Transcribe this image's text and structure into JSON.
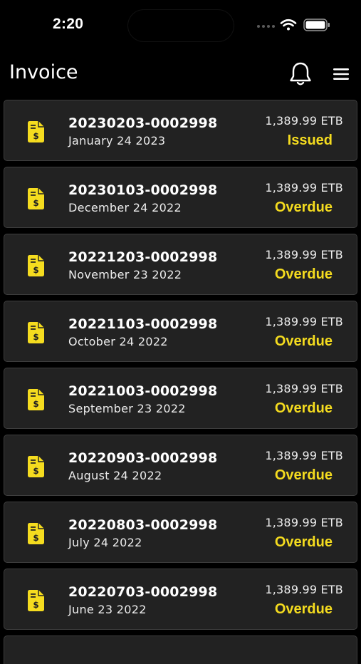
{
  "status_bar": {
    "time": "2:20",
    "icons": [
      "signal-icon",
      "wifi-icon",
      "battery-icon"
    ]
  },
  "header": {
    "title": "Invoice",
    "icons": [
      "bell-icon",
      "hamburger-menu-icon"
    ]
  },
  "colors": {
    "background": "#000000",
    "card": "#222222",
    "card_border": "#3e3e3e",
    "accent": "#f5dc1f"
  },
  "invoices": [
    {
      "number": "20230203-0002998",
      "date": "January 24 2023",
      "amount": "1,389.99 ETB",
      "status": "Issued",
      "icon": "invoice-dollar-icon"
    },
    {
      "number": "20230103-0002998",
      "date": "December 24 2022",
      "amount": "1,389.99 ETB",
      "status": "Overdue",
      "icon": "invoice-dollar-icon"
    },
    {
      "number": "20221203-0002998",
      "date": "November 23 2022",
      "amount": "1,389.99 ETB",
      "status": "Overdue",
      "icon": "invoice-dollar-icon"
    },
    {
      "number": "20221103-0002998",
      "date": "October 24 2022",
      "amount": "1,389.99 ETB",
      "status": "Overdue",
      "icon": "invoice-dollar-icon"
    },
    {
      "number": "20221003-0002998",
      "date": "September 23 2022",
      "amount": "1,389.99 ETB",
      "status": "Overdue",
      "icon": "invoice-dollar-icon"
    },
    {
      "number": "20220903-0002998",
      "date": "August 24 2022",
      "amount": "1,389.99 ETB",
      "status": "Overdue",
      "icon": "invoice-dollar-icon"
    },
    {
      "number": "20220803-0002998",
      "date": "July 24 2022",
      "amount": "1,389.99 ETB",
      "status": "Overdue",
      "icon": "invoice-dollar-icon"
    },
    {
      "number": "20220703-0002998",
      "date": "June 23 2022",
      "amount": "1,389.99 ETB",
      "status": "Overdue",
      "icon": "invoice-dollar-icon"
    }
  ]
}
